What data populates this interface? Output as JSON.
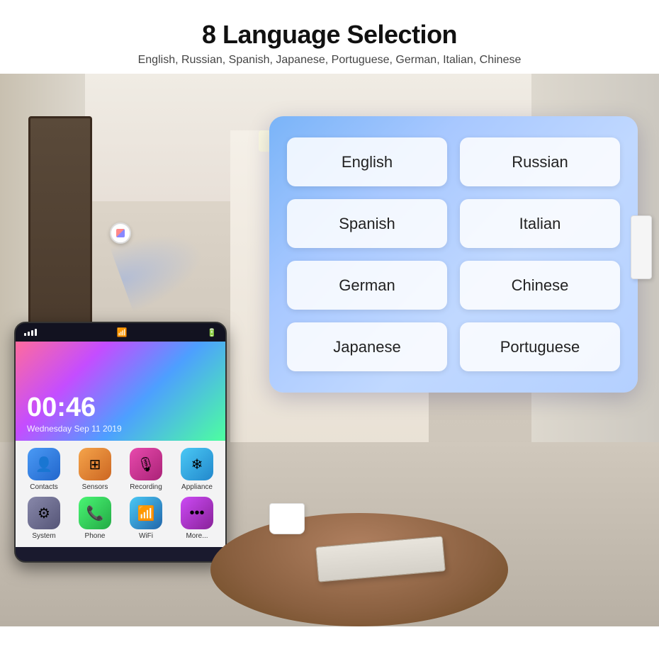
{
  "header": {
    "title": "8 Language Selection",
    "subtitle": "English, Russian, Spanish, Japanese, Portuguese, German, Italian, Chinese"
  },
  "languages": [
    {
      "label": "English"
    },
    {
      "label": "Russian"
    },
    {
      "label": "Spanish"
    },
    {
      "label": "Italian"
    },
    {
      "label": "German"
    },
    {
      "label": "Chinese"
    },
    {
      "label": "Japanese"
    },
    {
      "label": "Portuguese"
    }
  ],
  "phone": {
    "time": "00:46",
    "date": "Wednesday    Sep 11 2019",
    "apps": [
      {
        "label": "Contacts",
        "class": "app-contacts",
        "icon": "👤"
      },
      {
        "label": "Sensors",
        "class": "app-sensors",
        "icon": "⊞"
      },
      {
        "label": "Recording",
        "class": "app-recording",
        "icon": "🎙"
      },
      {
        "label": "Appliance",
        "class": "app-appliance",
        "icon": "❄"
      },
      {
        "label": "System",
        "class": "app-system",
        "icon": "⚙"
      },
      {
        "label": "Phone",
        "class": "app-phone",
        "icon": "📞"
      },
      {
        "label": "WiFi",
        "class": "app-wifi",
        "icon": "📶"
      },
      {
        "label": "More...",
        "class": "app-more",
        "icon": "•••"
      }
    ]
  },
  "colors": {
    "panel_gradient_start": "#7ab4f8",
    "panel_gradient_end": "#c0d8ff"
  }
}
